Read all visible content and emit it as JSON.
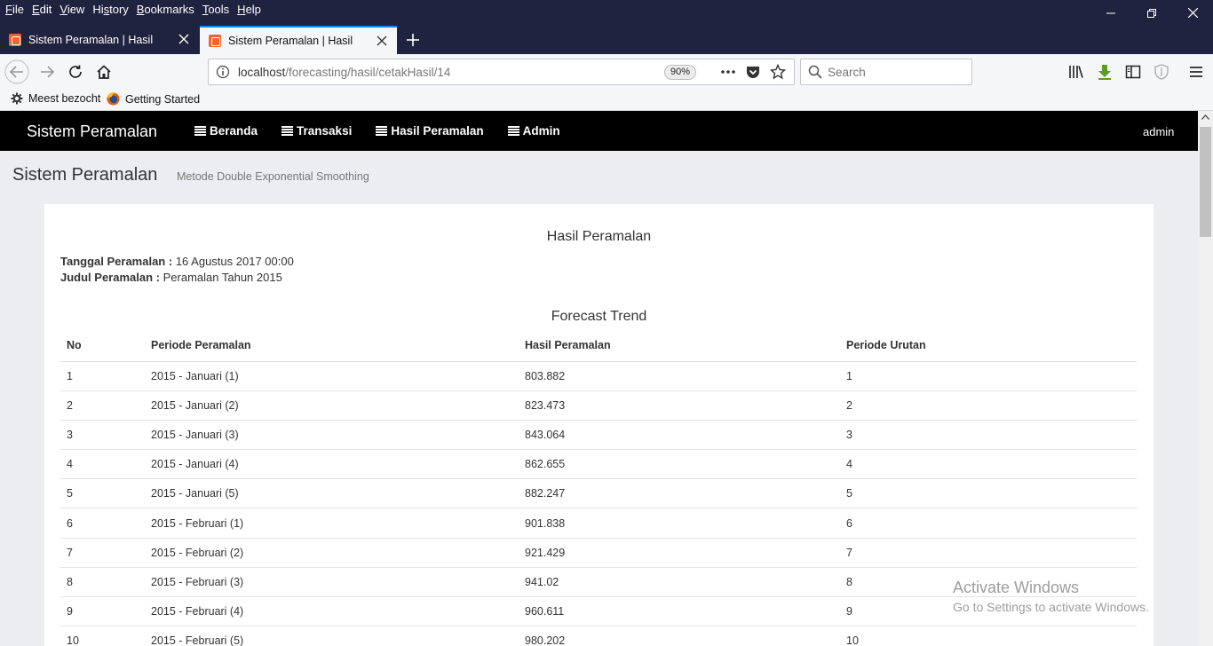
{
  "menubar": {
    "items": [
      {
        "label": "File",
        "u": "F",
        "rest": "ile"
      },
      {
        "label": "Edit",
        "u": "E",
        "rest": "dit"
      },
      {
        "label": "View",
        "u": "V",
        "rest": "iew"
      },
      {
        "label": "History",
        "u": "s",
        "pre": "Hi",
        "rest": "tory"
      },
      {
        "label": "Bookmarks",
        "u": "B",
        "rest": "ookmarks"
      },
      {
        "label": "Tools",
        "u": "T",
        "rest": "ools"
      },
      {
        "label": "Help",
        "u": "H",
        "rest": "elp"
      }
    ]
  },
  "tabs": [
    {
      "title": "Sistem Peramalan | Hasil",
      "active": false
    },
    {
      "title": "Sistem Peramalan | Hasil",
      "active": true
    }
  ],
  "urlbar": {
    "url_host": "localhost",
    "url_path": "/forecasting/hasil/cetakHasil/14",
    "zoom": "90%"
  },
  "search": {
    "placeholder": "Search"
  },
  "bookmarks": [
    {
      "label": "Meest bezocht",
      "icon": "gear-icon"
    },
    {
      "label": "Getting Started",
      "icon": "firefox-icon"
    }
  ],
  "app": {
    "brand": "Sistem Peramalan",
    "nav": [
      "Beranda",
      "Transaksi",
      "Hasil Peramalan",
      "Admin"
    ],
    "user": "admin",
    "page_title": "Sistem Peramalan",
    "page_subtitle": "Metode Double Exponential Smoothing"
  },
  "report": {
    "title": "Hasil Peramalan",
    "date_label": "Tanggal Peramalan :",
    "date_value": "16 Agustus 2017 00:00",
    "judul_label": "Judul Peramalan :",
    "judul_value": "Peramalan Tahun 2015",
    "table_title": "Forecast Trend",
    "columns": [
      "No",
      "Periode Peramalan",
      "Hasil Peramalan",
      "Periode Urutan"
    ],
    "rows": [
      [
        "1",
        "2015 - Januari (1)",
        "803.882",
        "1"
      ],
      [
        "2",
        "2015 - Januari (2)",
        "823.473",
        "2"
      ],
      [
        "3",
        "2015 - Januari (3)",
        "843.064",
        "3"
      ],
      [
        "4",
        "2015 - Januari (4)",
        "862.655",
        "4"
      ],
      [
        "5",
        "2015 - Januari (5)",
        "882.247",
        "5"
      ],
      [
        "6",
        "2015 - Februari (1)",
        "901.838",
        "6"
      ],
      [
        "7",
        "2015 - Februari (2)",
        "921.429",
        "7"
      ],
      [
        "8",
        "2015 - Februari (3)",
        "941.02",
        "8"
      ],
      [
        "9",
        "2015 - Februari (4)",
        "960.611",
        "9"
      ],
      [
        "10",
        "2015 - Februari (5)",
        "980.202",
        "10"
      ]
    ]
  },
  "watermark": {
    "line1": "Activate Windows",
    "line2": "Go to Settings to activate Windows."
  }
}
